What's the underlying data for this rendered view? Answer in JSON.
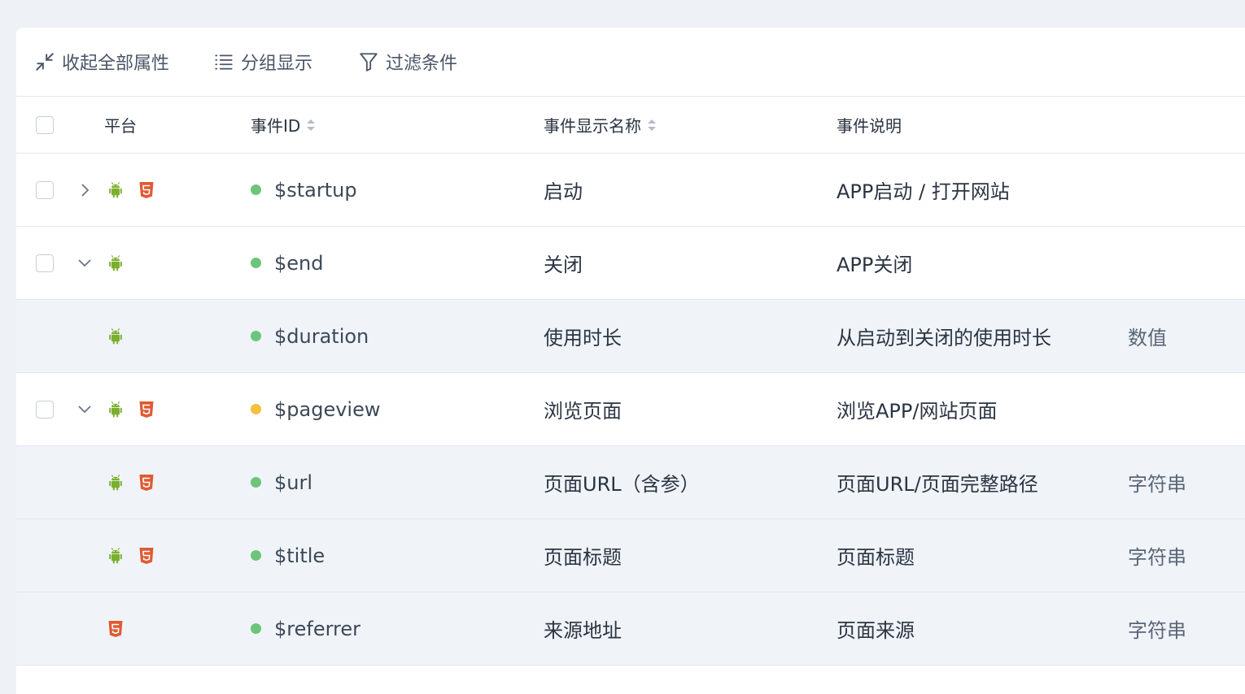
{
  "toolbar": {
    "collapse_label": "收起全部属性",
    "group_label": "分组显示",
    "filter_label": "过滤条件"
  },
  "table": {
    "headers": {
      "platform": "平台",
      "event_id": "事件ID",
      "display_name": "事件显示名称",
      "description": "事件说明"
    },
    "rows": [
      {
        "kind": "event",
        "expand": "collapsed",
        "platforms": [
          "android-icon",
          "html5-icon"
        ],
        "status_color": "#6cc57a",
        "event_id": "$startup",
        "display_name": "启动",
        "description": "APP启动 / 打开网站",
        "type": ""
      },
      {
        "kind": "event",
        "expand": "expanded",
        "platforms": [
          "android-icon"
        ],
        "status_color": "#6cc57a",
        "event_id": "$end",
        "display_name": "关闭",
        "description": "APP关闭",
        "type": ""
      },
      {
        "kind": "property",
        "expand": "",
        "platforms": [
          "android-icon"
        ],
        "status_color": "#6cc57a",
        "event_id": "$duration",
        "display_name": "使用时长",
        "description": "从启动到关闭的使用时长",
        "type": "数值"
      },
      {
        "kind": "event",
        "expand": "expanded",
        "platforms": [
          "android-icon",
          "html5-icon"
        ],
        "status_color": "#f3c13f",
        "event_id": "$pageview",
        "display_name": "浏览页面",
        "description": "浏览APP/网站页面",
        "type": ""
      },
      {
        "kind": "property",
        "expand": "",
        "platforms": [
          "android-icon",
          "html5-icon"
        ],
        "status_color": "#6cc57a",
        "event_id": "$url",
        "display_name": "页面URL（含参）",
        "description": "页面URL/页面完整路径",
        "type": "字符串"
      },
      {
        "kind": "property",
        "expand": "",
        "platforms": [
          "android-icon",
          "html5-icon"
        ],
        "status_color": "#6cc57a",
        "event_id": "$title",
        "display_name": "页面标题",
        "description": "页面标题",
        "type": "字符串"
      },
      {
        "kind": "property",
        "expand": "",
        "platforms": [
          "html5-icon"
        ],
        "status_color": "#6cc57a",
        "event_id": "$referrer",
        "display_name": "来源地址",
        "description": "页面来源",
        "type": "字符串"
      }
    ]
  },
  "colors": {
    "android": "#7cae2f",
    "html5": "#e05a33"
  }
}
